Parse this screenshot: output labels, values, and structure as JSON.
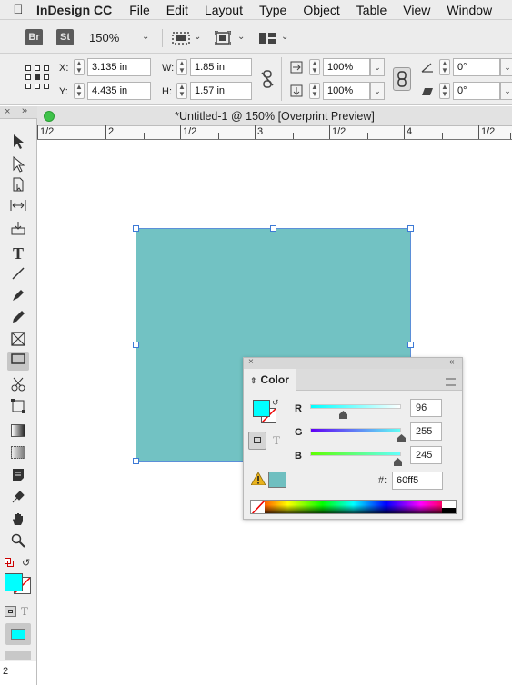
{
  "menubar": {
    "app_name": "InDesign CC",
    "menus": [
      "File",
      "Edit",
      "Layout",
      "Type",
      "Object",
      "Table",
      "View",
      "Window"
    ]
  },
  "appbar": {
    "bridge_label": "Br",
    "stock_label": "St",
    "zoom": "150%"
  },
  "control": {
    "x_label": "X:",
    "x_value": "3.135 in",
    "y_label": "Y:",
    "y_value": "4.435 in",
    "w_label": "W:",
    "w_value": "1.85 in",
    "h_label": "H:",
    "h_value": "1.57 in",
    "scale_x": "100%",
    "scale_y": "100%",
    "rotate": "0°",
    "shear": "0°"
  },
  "document": {
    "title": "*Untitled-1 @ 150% [Overprint Preview]",
    "ruler_labels": [
      "1/2",
      "2",
      "1/2",
      "3",
      "1/2",
      "4",
      "1/2"
    ],
    "page_number": "2",
    "rect_color": "#72c2c3"
  },
  "color_panel": {
    "tab": "Color",
    "r_label": "R",
    "r_value": "96",
    "g_label": "G",
    "g_value": "255",
    "b_label": "B",
    "b_value": "245",
    "hex_label": "#:",
    "hex_value": "60ff5",
    "fill_color": "#00ffff",
    "gamut_swatch": "#6fbfc0",
    "text_toggle": "T"
  },
  "tools_panel": {
    "text_toggle": "T",
    "fill_color": "#00ffff"
  }
}
